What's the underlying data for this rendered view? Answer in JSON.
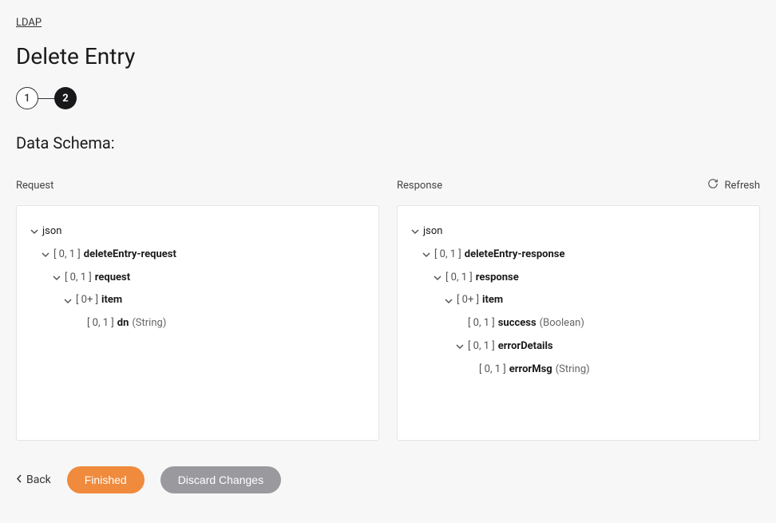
{
  "breadcrumb": "LDAP",
  "page_title": "Delete Entry",
  "stepper": {
    "step1": "1",
    "step2": "2"
  },
  "section_title": "Data Schema:",
  "refresh_label": "Refresh",
  "request": {
    "label": "Request",
    "root": "json",
    "tree": {
      "n1_card": "[ 0, 1 ]",
      "n1_name": "deleteEntry-request",
      "n2_card": "[ 0, 1 ]",
      "n2_name": "request",
      "n3_card": "[ 0+ ]",
      "n3_name": "item",
      "n4_card": "[ 0, 1 ]",
      "n4_name": "dn",
      "n4_type": "(String)"
    }
  },
  "response": {
    "label": "Response",
    "root": "json",
    "tree": {
      "n1_card": "[ 0, 1 ]",
      "n1_name": "deleteEntry-response",
      "n2_card": "[ 0, 1 ]",
      "n2_name": "response",
      "n3_card": "[ 0+ ]",
      "n3_name": "item",
      "n4_card": "[ 0, 1 ]",
      "n4_name": "success",
      "n4_type": "(Boolean)",
      "n5_card": "[ 0, 1 ]",
      "n5_name": "errorDetails",
      "n6_card": "[ 0, 1 ]",
      "n6_name": "errorMsg",
      "n6_type": "(String)"
    }
  },
  "footer": {
    "back": "Back",
    "finished": "Finished",
    "discard": "Discard Changes"
  }
}
